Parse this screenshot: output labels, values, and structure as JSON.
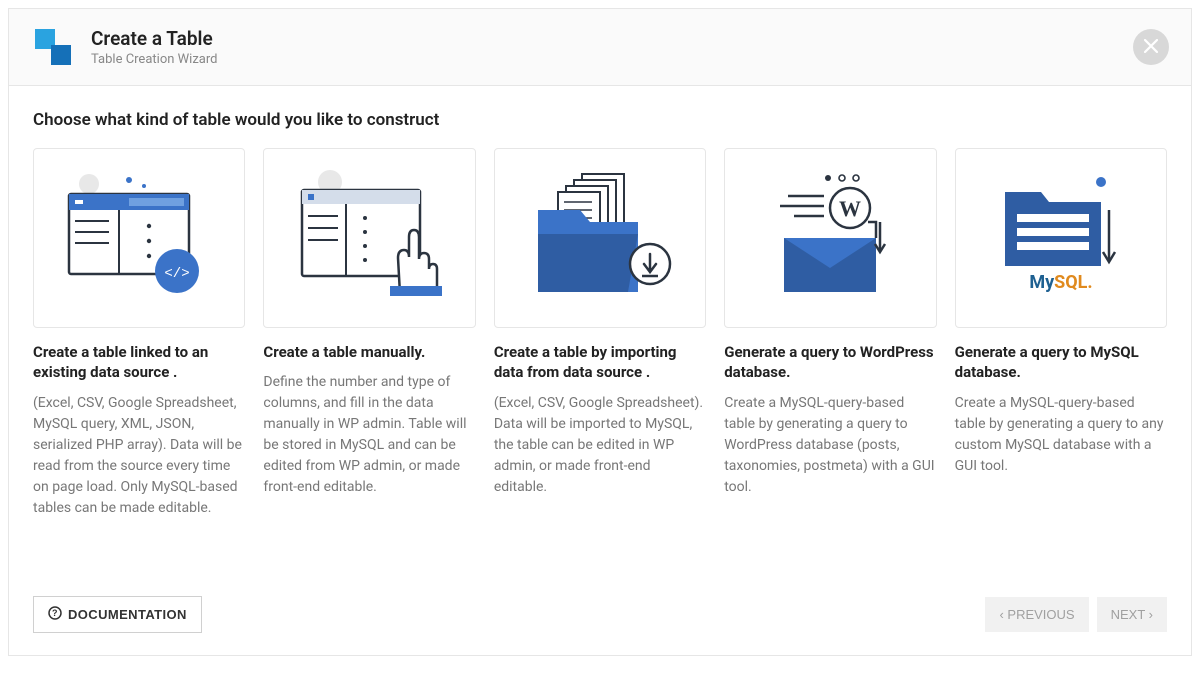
{
  "header": {
    "title": "Create a Table",
    "subtitle": "Table Creation Wizard"
  },
  "main": {
    "heading": "Choose what kind of table would you like to construct"
  },
  "cards": [
    {
      "title": "Create a table linked to an existing data source .",
      "desc": "(Excel, CSV, Google Spreadsheet, MySQL query, XML, JSON, serialized PHP array). Data will be read from the source every time on page load. Only MySQL-based tables can be made editable."
    },
    {
      "title": "Create a table manually.",
      "desc": "Define the number and type of columns, and fill in the data manually in WP admin. Table will be stored in MySQL and can be edited from WP admin, or made front-end editable."
    },
    {
      "title": "Create a table by importing data from data source .",
      "desc": "(Excel, CSV, Google Spreadsheet). Data will be imported to MySQL, the table can be edited in WP admin, or made front-end editable."
    },
    {
      "title": "Generate a query to WordPress database.",
      "desc": "Create a MySQL-query-based table by generating a query to WordPress database (posts, taxonomies, postmeta) with a GUI tool."
    },
    {
      "title": "Generate a query to MySQL database.",
      "desc": "Create a MySQL-query-based table by generating a query to any custom MySQL database with a GUI tool."
    }
  ],
  "footer": {
    "documentation": "DOCUMENTATION",
    "previous": "PREVIOUS",
    "next": "NEXT"
  },
  "mysql_label": "MySQL."
}
